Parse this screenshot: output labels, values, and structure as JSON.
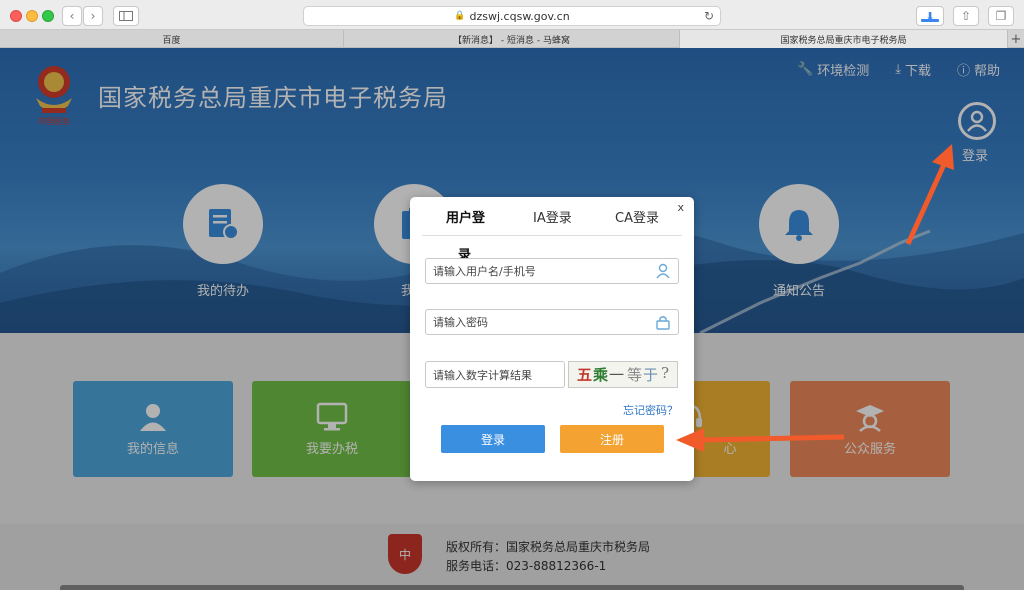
{
  "browser": {
    "url": "dzswj.cqsw.gov.cn",
    "tabs": [
      {
        "label": "百度",
        "active": false
      },
      {
        "label": "【新消息】 - 短消息 - 马蜂窝",
        "active": false
      },
      {
        "label": "国家税务总局重庆市电子税务局",
        "active": true
      }
    ],
    "new_tab": "+"
  },
  "header": {
    "site_title": "国家税务总局重庆市电子税务局",
    "links": [
      {
        "label": "环境检测",
        "icon": "wrench-icon"
      },
      {
        "label": "下载",
        "icon": "download-icon"
      },
      {
        "label": "帮助",
        "icon": "help-icon"
      }
    ],
    "login_label": "登录"
  },
  "quick_links": [
    {
      "label": "我的待办",
      "icon": "todo-list-icon"
    },
    {
      "label": "我要",
      "icon": "clipboard-icon"
    },
    {
      "label": "通知公告",
      "icon": "bell-icon"
    }
  ],
  "cards": [
    {
      "label": "我的信息",
      "icon": "user-icon",
      "color": "#4fa7db"
    },
    {
      "label": "我要办税",
      "icon": "monitor-icon",
      "color": "#72c047"
    },
    {
      "label": "",
      "icon": "",
      "color": "#2fb3a8"
    },
    {
      "label": "心",
      "icon": "headset-icon",
      "color": "#f3b333"
    },
    {
      "label": "公众服务",
      "icon": "graduate-icon",
      "color": "#f08a5b"
    }
  ],
  "modal": {
    "close": "x",
    "tabs": [
      "用户登",
      "IA登录",
      "CA登录"
    ],
    "tab_overflow": "录",
    "username_placeholder": "请输入用户名/手机号",
    "password_placeholder": "请输入密码",
    "captcha_placeholder": "请输入数字计算结果",
    "captcha_text": [
      "五",
      "乘",
      "一",
      "等",
      "于",
      "?"
    ],
    "forgot": "忘记密码？",
    "login_button": "登录",
    "register_button": "注册"
  },
  "footer": {
    "emblem_text": "中",
    "copyright": "版权所有：国家税务总局重庆市税务局",
    "phone": "服务电话：023-88812366-1"
  },
  "colors": {
    "banner": "#3a82c9",
    "primary_button": "#3a8fe0",
    "register_button": "#f4a231",
    "arrow": "#f15a2b"
  }
}
